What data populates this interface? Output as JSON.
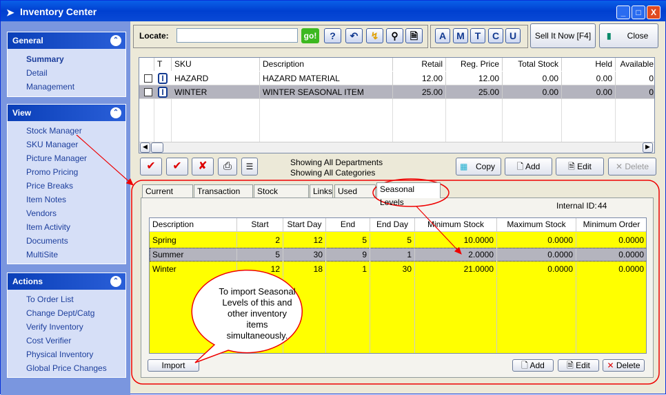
{
  "window": {
    "title": "Inventory Center",
    "buttons": [
      "_",
      "□",
      "X"
    ]
  },
  "sidebar": {
    "general": {
      "title": "General",
      "items": [
        "Summary",
        "Detail",
        "Management"
      ]
    },
    "view": {
      "title": "View",
      "items": [
        "Stock Manager",
        "SKU Manager",
        "Picture Manager",
        "Promo Pricing",
        "Price Breaks",
        "Item Notes",
        "Vendors",
        "Item Activity",
        "Documents",
        "MultiSite"
      ]
    },
    "actions": {
      "title": "Actions",
      "items": [
        "To Order List",
        "Change Dept/Catg",
        "Verify Inventory",
        "Cost Verifier",
        "Physical Inventory",
        "Global Price Changes"
      ]
    }
  },
  "toolbar": {
    "locate_label": "Locate:",
    "locate_value": "",
    "go": "go!",
    "help": "?",
    "letters": [
      "A",
      "M",
      "T",
      "C",
      "U"
    ],
    "sell": "Sell It Now [F4]",
    "close": "Close"
  },
  "items_grid": {
    "columns": [
      "",
      "T",
      "SKU",
      "Description",
      "Retail",
      "Reg. Price",
      "Total Stock",
      "Held",
      "Available"
    ],
    "rows": [
      {
        "sku": "HAZARD",
        "desc": "HAZARD MATERIAL",
        "retail": "12.00",
        "reg": "12.00",
        "total": "0.00",
        "held": "0.00",
        "avail": "0",
        "selected": false
      },
      {
        "sku": "WINTER",
        "desc": "WINTER SEASONAL ITEM",
        "retail": "25.00",
        "reg": "25.00",
        "total": "0.00",
        "held": "0.00",
        "avail": "0",
        "selected": true
      }
    ]
  },
  "filter": {
    "dept": "Showing All Departments",
    "cat": "Showing All Categories"
  },
  "grid_actions": {
    "copy": "Copy",
    "add": "Add",
    "edit": "Edit",
    "delete": "Delete"
  },
  "tabs": [
    "Current Stock",
    "Transaction Log",
    "Stock Location",
    "Links",
    "Used Items",
    "Seasonal Levels"
  ],
  "active_tab": "Seasonal Levels",
  "seasonal": {
    "internal_id_label": "Internal ID:",
    "internal_id": "44",
    "columns": [
      "Description",
      "Start Month",
      "Start Day",
      "End Month",
      "End Day",
      "Minimum Stock",
      "Maximum Stock",
      "Minimum Order"
    ],
    "rows": [
      [
        "Spring",
        "2",
        "12",
        "5",
        "5",
        "10.0000",
        "0.0000",
        "0.0000"
      ],
      [
        "Summer",
        "5",
        "30",
        "9",
        "1",
        "2.0000",
        "0.0000",
        "0.0000"
      ],
      [
        "Winter",
        "12",
        "18",
        "1",
        "30",
        "21.0000",
        "0.0000",
        "0.0000"
      ]
    ],
    "selected_row": 1,
    "import": "Import",
    "add": "Add",
    "edit": "Edit",
    "delete": "Delete"
  },
  "callout": "To import Seasonal Levels of this and other inventory items simultaneously.",
  "colors": {
    "row_highlight": "#ffff00",
    "row_selected": "#b4b4be",
    "annotation": "#e00000",
    "title_bar": "#0a5fe8"
  }
}
